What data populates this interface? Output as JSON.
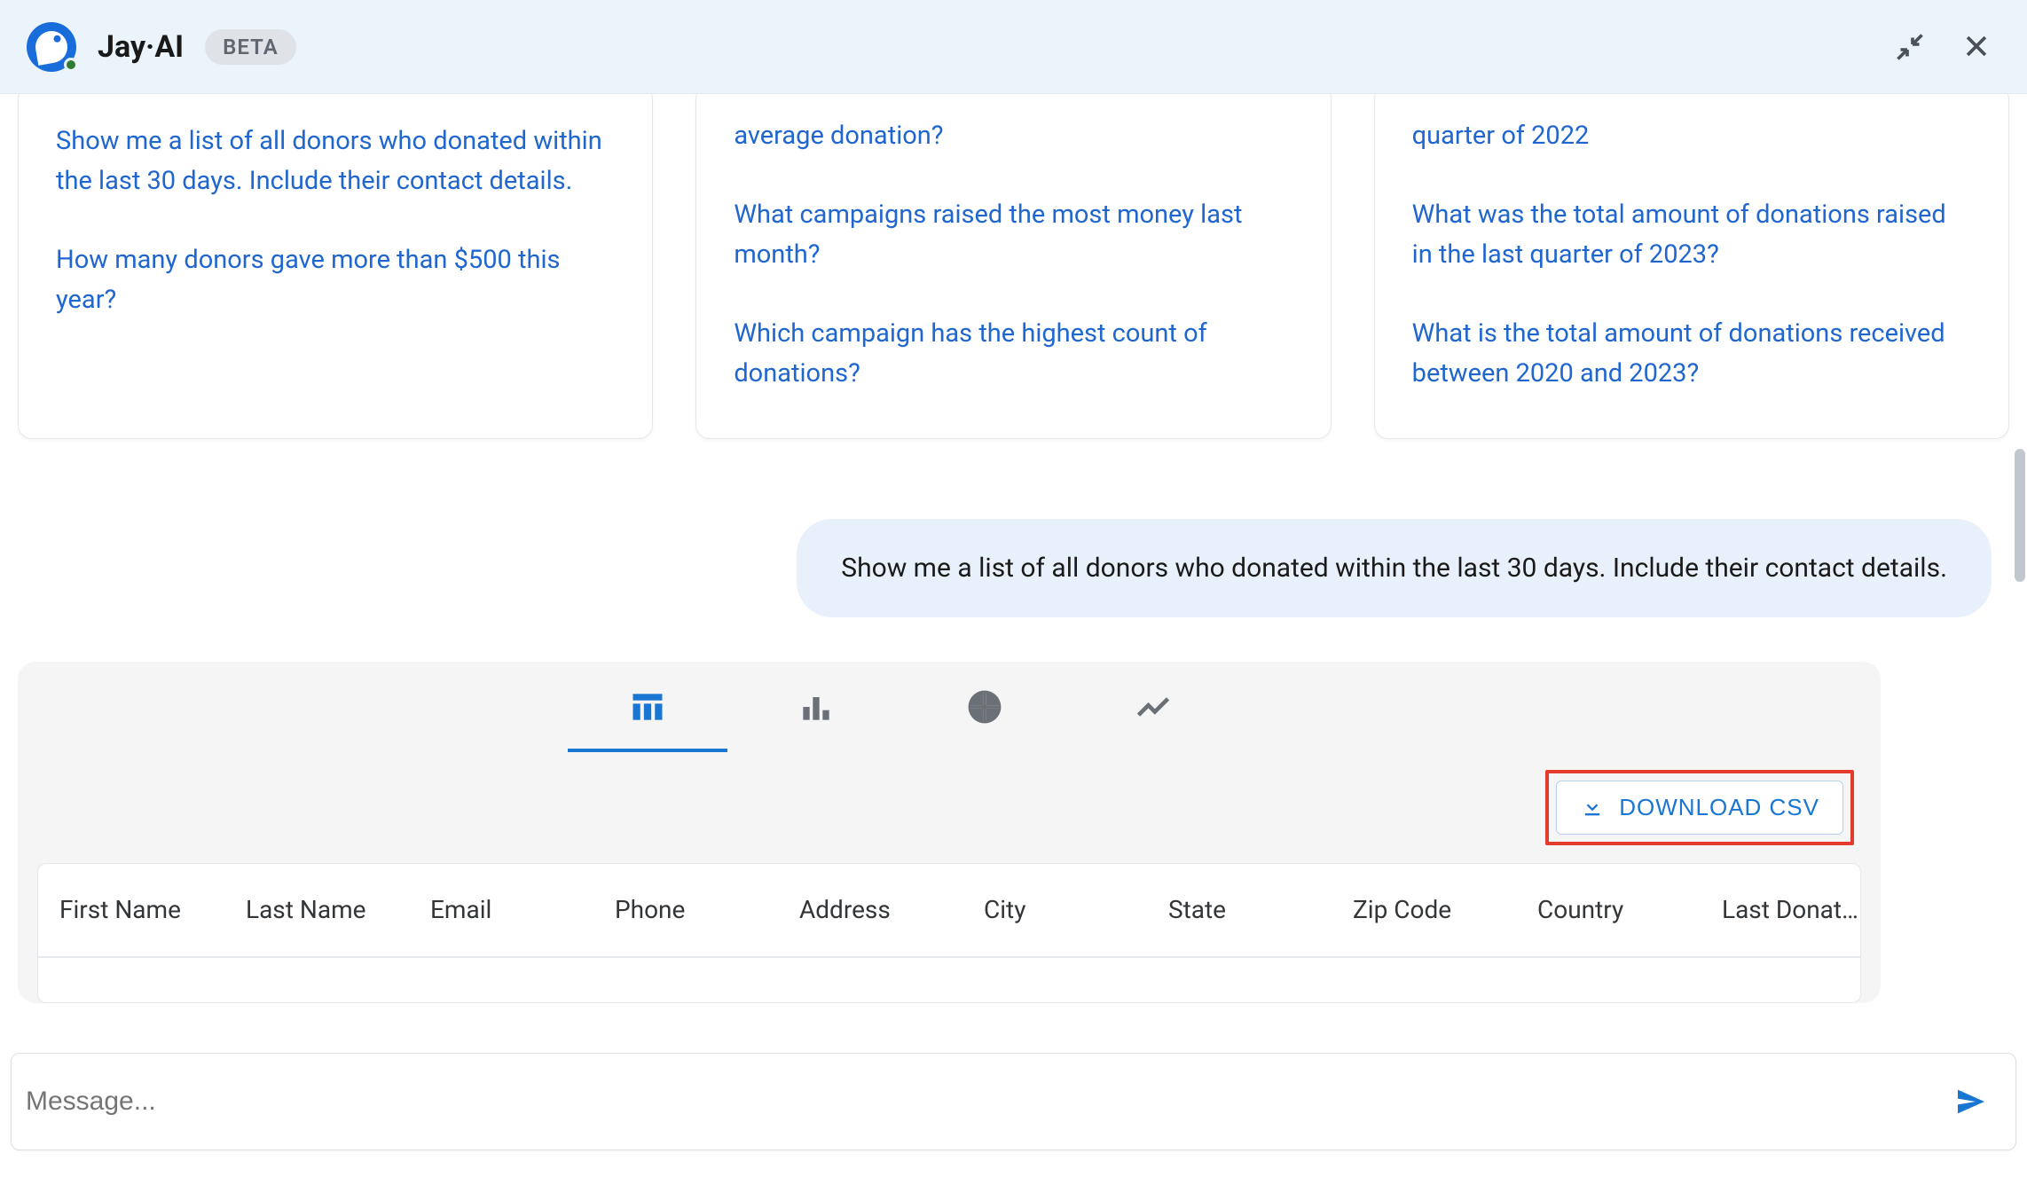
{
  "header": {
    "title": "Jay·AI",
    "badge": "BETA"
  },
  "cards": [
    {
      "suggestions": [
        "Show me a list of all donors who donated within the last 30 days. Include their contact details.",
        "How many donors gave more than $500 this year?"
      ]
    },
    {
      "suggestions": [
        "average donation?",
        "What campaigns raised the most money last month?",
        "Which campaign has the highest count of donations?"
      ]
    },
    {
      "suggestions": [
        "quarter of 2022",
        "What was the total amount of donations raised in the last quarter of 2023?",
        "What is the total amount of donations received between 2020 and 2023?"
      ]
    }
  ],
  "user_message": "Show me a list of all donors who donated within the last 30 days. Include their contact details.",
  "download_label": "DOWNLOAD CSV",
  "table": {
    "columns": [
      "First Name",
      "Last Name",
      "Email",
      "Phone",
      "Address",
      "City",
      "State",
      "Zip Code",
      "Country",
      "Last Donat…"
    ],
    "widths": [
      200,
      200,
      200,
      200,
      200,
      200,
      200,
      200,
      200,
      200
    ]
  },
  "input": {
    "placeholder": "Message..."
  }
}
